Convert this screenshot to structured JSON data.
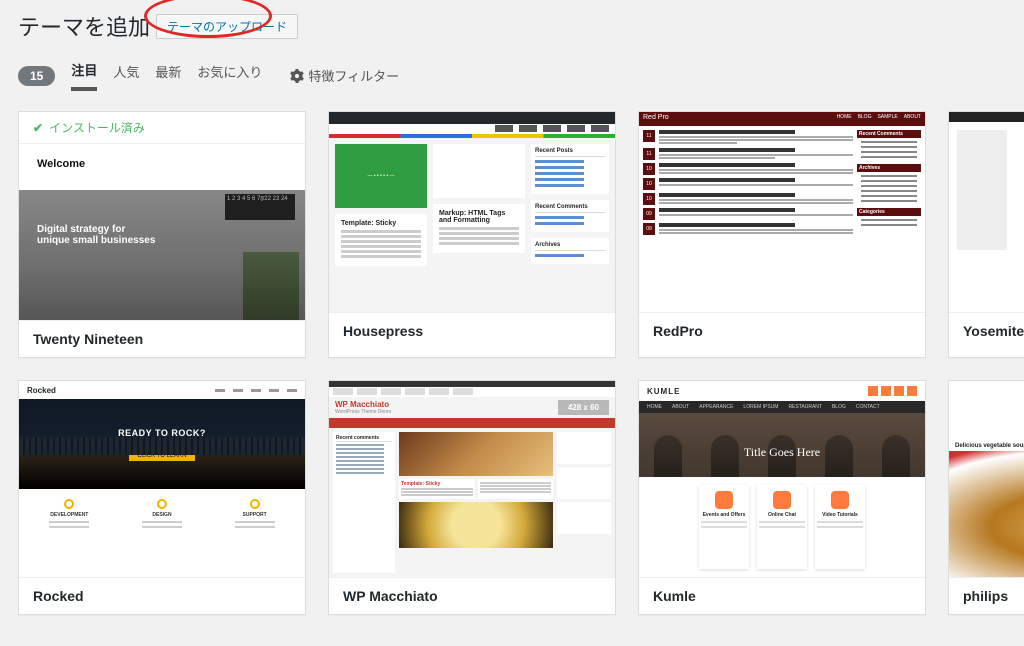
{
  "header": {
    "title": "テーマを追加",
    "upload_button": "テーマのアップロード"
  },
  "filter": {
    "count": "15",
    "tabs": {
      "featured": "注目",
      "popular": "人気",
      "latest": "最新",
      "favorites": "お気に入り"
    },
    "feature_filter": "特徴フィルター"
  },
  "themes": [
    {
      "name": "Twenty Nineteen",
      "installed_label": "インストール済み",
      "preview": {
        "welcome": "Welcome",
        "hero1": "Digital strategy for",
        "hero2": "unique small businesses"
      }
    },
    {
      "name": "Housepress",
      "preview": {
        "sticky_title": "Template: Sticky",
        "markup_title": "Markup: HTML Tags and Formatting",
        "side1": "Recent Posts",
        "side2": "Recent Comments",
        "side3": "Archives"
      }
    },
    {
      "name": "RedPro",
      "preview": {
        "brand": "Red Pro",
        "widgets": [
          "Recent Comments",
          "Archives",
          "Categories"
        ]
      }
    },
    {
      "name": "Yosemite Lite"
    },
    {
      "name": "Rocked",
      "preview": {
        "logo": "Rocked",
        "hero": "READY TO ROCK?",
        "features": [
          "DEVELOPMENT",
          "DESIGN",
          "SUPPORT"
        ]
      }
    },
    {
      "name": "WP Macchiato",
      "preview": {
        "title": "WP Macchiato",
        "sub": "WordPress Theme Demo",
        "ad": "428 x 60",
        "side": "Recent comments",
        "sticky": "Template: Sticky"
      }
    },
    {
      "name": "Kumle",
      "preview": {
        "logo": "KUMLE",
        "menu": [
          "HOME",
          "ABOUT",
          "APPEARANCE",
          "LOREM IPSUM",
          "RESTAURANT",
          "BLOG",
          "CONTACT"
        ],
        "hero": "Title Goes Here",
        "cards": [
          "Events and Offers",
          "Online Chat",
          "Video Tutorials"
        ]
      }
    },
    {
      "name": "philips",
      "preview": {
        "title": "Delicious vegetable soup"
      }
    }
  ]
}
